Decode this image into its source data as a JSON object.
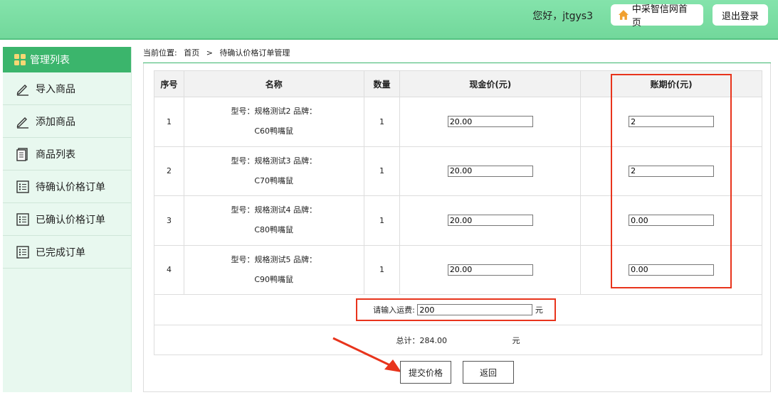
{
  "header": {
    "greeting": "您好，jtgys3",
    "home_button": "中采智信网首页",
    "logout_button": "退出登录"
  },
  "sidebar": {
    "title": "管理列表",
    "items": [
      {
        "label": "导入商品",
        "icon": "pencil-icon"
      },
      {
        "label": "添加商品",
        "icon": "pencil-icon"
      },
      {
        "label": "商品列表",
        "icon": "document-icon"
      },
      {
        "label": "待确认价格订单",
        "icon": "list-icon"
      },
      {
        "label": "已确认价格订单",
        "icon": "list-icon"
      },
      {
        "label": "已完成订单",
        "icon": "list-icon"
      }
    ]
  },
  "breadcrumb": {
    "prefix": "当前位置:",
    "home": "首页",
    "separator": ">",
    "current": "待确认价格订单管理"
  },
  "table": {
    "headers": [
      "序号",
      "名称",
      "数量",
      "现金价(元)",
      "账期价(元)"
    ],
    "rows": [
      {
        "no": "1",
        "name_line1": "型号：规格测试2  品牌：",
        "name_line2": "C60鸭嘴鼠",
        "qty": "1",
        "cash_price": "20.00",
        "term_price": "2"
      },
      {
        "no": "2",
        "name_line1": "型号：规格测试3  品牌：",
        "name_line2": "C70鸭嘴鼠",
        "qty": "1",
        "cash_price": "20.00",
        "term_price": "2"
      },
      {
        "no": "3",
        "name_line1": "型号：规格测试4  品牌：",
        "name_line2": "C80鸭嘴鼠",
        "qty": "1",
        "cash_price": "20.00",
        "term_price": "0.00"
      },
      {
        "no": "4",
        "name_line1": "型号：规格测试5  品牌：",
        "name_line2": "C90鸭嘴鼠",
        "qty": "1",
        "cash_price": "20.00",
        "term_price": "0.00"
      }
    ],
    "freight_label": "请输入运费:",
    "freight_value": "200",
    "freight_unit": "元",
    "total_label": "总计：284.00",
    "total_unit": "元"
  },
  "buttons": {
    "submit": "提交价格",
    "back": "返回"
  },
  "colors": {
    "header_green": "#7ddfa4",
    "sidebar_active": "#3bb56c",
    "highlight_red": "#e8341c"
  }
}
